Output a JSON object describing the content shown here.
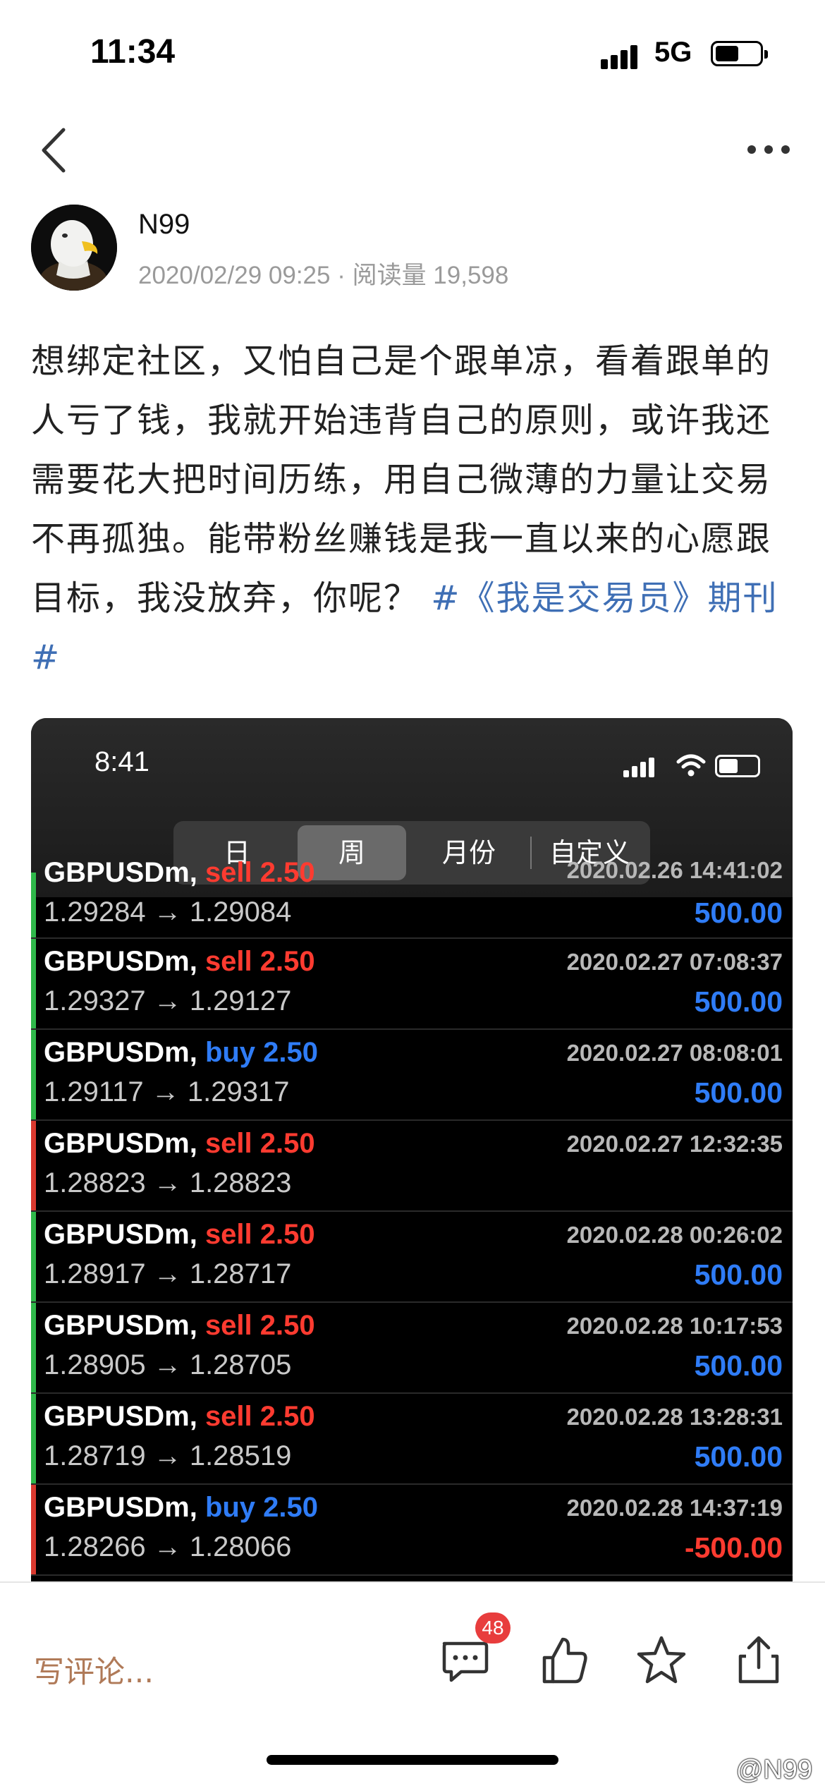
{
  "status_bar": {
    "time": "11:34",
    "network": "5G"
  },
  "author": {
    "name": "N99",
    "meta": "2020/02/29 09:25 · 阅读量 19,598"
  },
  "post": {
    "text": "想绑定社区，又怕自己是个跟单凉，看着跟单的人亏了钱，我就开始违背自己的原则，或许我还需要花大把时间历练，用自己微薄的力量让交易不再孤独。能带粉丝赚钱是我一直以来的心愿跟目标，我没放弃，你呢？",
    "hashtag": "#《我是交易员》期刊#"
  },
  "embedded": {
    "time": "8:41",
    "segments": [
      "日",
      "周",
      "月份",
      "自定义"
    ],
    "active_segment": "周",
    "trades": [
      {
        "symbol": "GBPUSDm,",
        "side": "sell 2.50",
        "time": "2020.02.26 14:41:02",
        "price": "1.29284 → 1.29084",
        "profit": "500.00",
        "result": "win"
      },
      {
        "symbol": "GBPUSDm,",
        "side": "sell 2.50",
        "time": "2020.02.27 07:08:37",
        "price": "1.29327 → 1.29127",
        "profit": "500.00",
        "result": "win"
      },
      {
        "symbol": "GBPUSDm,",
        "side": "buy 2.50",
        "time": "2020.02.27 08:08:01",
        "price": "1.29117 → 1.29317",
        "profit": "500.00",
        "result": "win"
      },
      {
        "symbol": "GBPUSDm,",
        "side": "sell 2.50",
        "time": "2020.02.27 12:32:35",
        "price": "1.28823 → 1.28823",
        "profit": "",
        "result": "loss"
      },
      {
        "symbol": "GBPUSDm,",
        "side": "sell 2.50",
        "time": "2020.02.28 00:26:02",
        "price": "1.28917 → 1.28717",
        "profit": "500.00",
        "result": "win"
      },
      {
        "symbol": "GBPUSDm,",
        "side": "sell 2.50",
        "time": "2020.02.28 10:17:53",
        "price": "1.28905 → 1.28705",
        "profit": "500.00",
        "result": "win"
      },
      {
        "symbol": "GBPUSDm,",
        "side": "sell 2.50",
        "time": "2020.02.28 13:28:31",
        "price": "1.28719 → 1.28519",
        "profit": "500.00",
        "result": "win"
      },
      {
        "symbol": "GBPUSDm,",
        "side": "buy 2.50",
        "time": "2020.02.28 14:37:19",
        "price": "1.28266 → 1.28066",
        "profit": "-500.00",
        "result": "loss"
      }
    ]
  },
  "bottom_bar": {
    "comment_placeholder": "写评论...",
    "comment_count": "48",
    "watermark": "@N99"
  },
  "colors": {
    "sell": "#ff3b30",
    "buy": "#2f7cf6",
    "profit": "#2f7cf6",
    "loss_profit": "#ff3b30",
    "win_edge": "#2fb84a",
    "loss_edge": "#d9392f",
    "hashtag": "#3f6fb5"
  }
}
